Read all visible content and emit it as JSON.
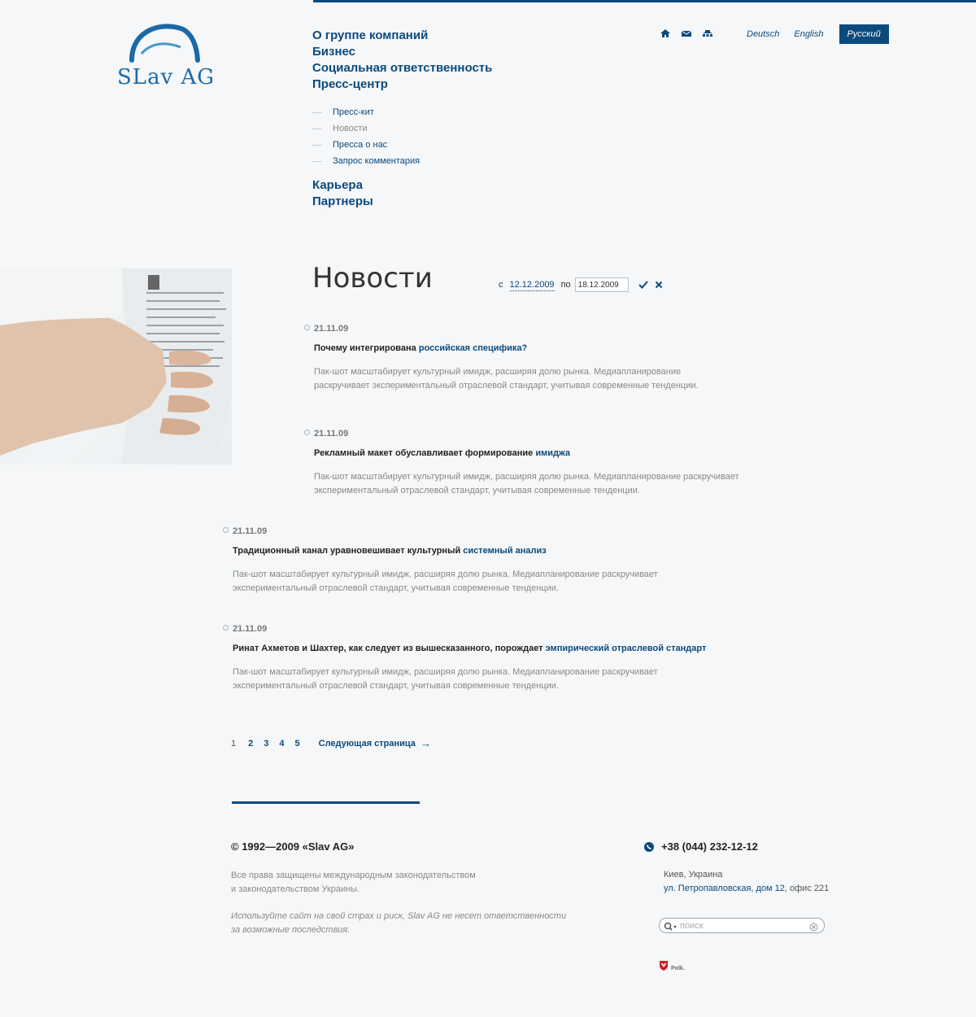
{
  "brand": {
    "logo_text": "SLav AG"
  },
  "nav": {
    "main": [
      "О группе компаний",
      "Бизнес",
      "Социальная ответственность",
      "Пресс-центр"
    ],
    "sub": [
      "Пресс-кит",
      "Новости",
      "Пресса о нас",
      "Запрос комментария"
    ],
    "main2": [
      "Карьера",
      "Партнеры"
    ]
  },
  "top_icons": [
    "home-icon",
    "mail-icon",
    "sitemap-icon"
  ],
  "langs": {
    "de": "Deutsch",
    "en": "English",
    "ru": "Русский"
  },
  "page": {
    "title": "Новости"
  },
  "filter": {
    "from_label": "с",
    "from_date": "12.12.2009",
    "to_label": "по",
    "to_date": "18.12.2009"
  },
  "news": [
    {
      "date": "21.11.09",
      "head": "Почему интегрирована ",
      "link": "российская специфика?",
      "text": "Пак-шот масштабирует культурный имидж, расширяя долю рынка. Медиапланирование раскручивает экспериментальный отраслевой стандарт, учитывая современные тенденции."
    },
    {
      "date": "21.11.09",
      "head": "Рекламный макет обуславливает формирование ",
      "link": "имиджа",
      "text": "Пак-шот масштабирует культурный имидж, расширяя долю рынка. Медиапланирование раскручивает экспериментальный отраслевой стандарт, учитывая современные тенденции."
    },
    {
      "date": "21.11.09",
      "head": "Традиционный канал уравновешивает культурный ",
      "link": "системный анализ",
      "text": "Пак-шот масштабирует культурный имидж, расширяя долю рынка. Медиапланирование раскручивает экспериментальный отраслевой стандарт, учитывая современные тенденции."
    },
    {
      "date": "21.11.09",
      "head": "Ринат Ахметов и Шахтер, как следует из вышесказанного, порождает ",
      "link": "эмпирический отраслевой стандарт",
      "text": "Пак-шот масштабирует культурный имидж, расширяя долю рынка. Медиапланирование раскручивает экспериментальный отраслевой стандарт, учитывая современные тенденции."
    }
  ],
  "pager": {
    "current": "1",
    "pages": [
      "2",
      "3",
      "4",
      "5"
    ],
    "next": "Следующая страница",
    "next_arrow": "→"
  },
  "footer": {
    "copyright": "© 1992—2009 «Slav AG»",
    "rights_1": "Все права защищены международным законодательством",
    "rights_2": "и законодательством Украины.",
    "disclaimer_1": "Используйте сайт на свой страх и риск, Slav AG не несет ответственности",
    "disclaimer_2": "за возможные последствия.",
    "phone": "+38 (044) 232-12-12",
    "city": "Киев, Украина",
    "street": "ул. Петропавловская, дом 12",
    "office": ", офис 221",
    "search_placeholder": "поиск",
    "polk": "Polk."
  },
  "colors": {
    "accent": "#0b4a7d",
    "background": "#f5f7f9",
    "muted_text": "#888888"
  }
}
